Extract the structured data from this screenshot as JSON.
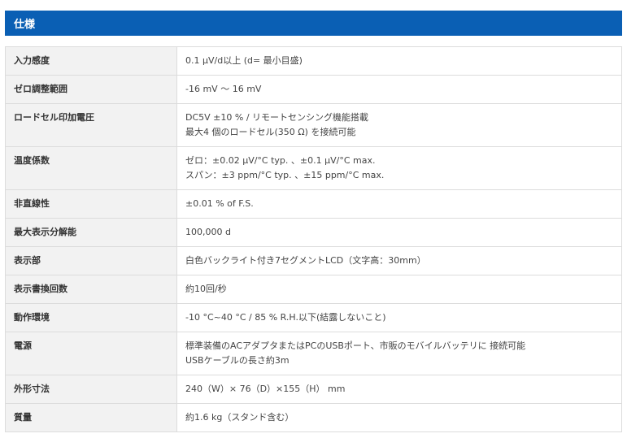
{
  "section": {
    "title": "仕様"
  },
  "rows": [
    {
      "label": "入力感度",
      "values": [
        "0.1 μV/d以上 (d= 最小目盛)"
      ]
    },
    {
      "label": "ゼロ調整範囲",
      "values": [
        "-16 mV ～ 16 mV"
      ]
    },
    {
      "label": "ロードセル印加電圧",
      "values": [
        "DC5V ±10 % / リモートセンシング機能搭載",
        "最大4 個のロードセル(350 Ω) を接続可能"
      ]
    },
    {
      "label": "温度係数",
      "values": [
        "ゼロ：±0.02 μV/°C typ. 、±0.1 μV/°C max.",
        "スパン：±3 ppm/°C typ. 、±15 ppm/°C max."
      ]
    },
    {
      "label": "非直線性",
      "values": [
        "±0.01 % of F.S."
      ]
    },
    {
      "label": "最大表示分解能",
      "values": [
        "100,000 d"
      ]
    },
    {
      "label": "表示部",
      "values": [
        "白色バックライト付き7セグメントLCD（文字高：30mm）"
      ]
    },
    {
      "label": "表示書換回数",
      "values": [
        "約10回/秒"
      ]
    },
    {
      "label": "動作環境",
      "values": [
        "-10 °C~40 °C / 85 % R.H.以下(結露しないこと)"
      ]
    },
    {
      "label": "電源",
      "values": [
        "標準装備のACアダプタまたはPCのUSBポート、市販のモバイルバッテリに 接続可能",
        "USBケーブルの長さ約3m"
      ]
    },
    {
      "label": "外形寸法",
      "values": [
        "240（W）× 76（D）×155（H） mm"
      ]
    },
    {
      "label": "質量",
      "values": [
        "約1.6 kg（スタンド含む）"
      ]
    }
  ]
}
